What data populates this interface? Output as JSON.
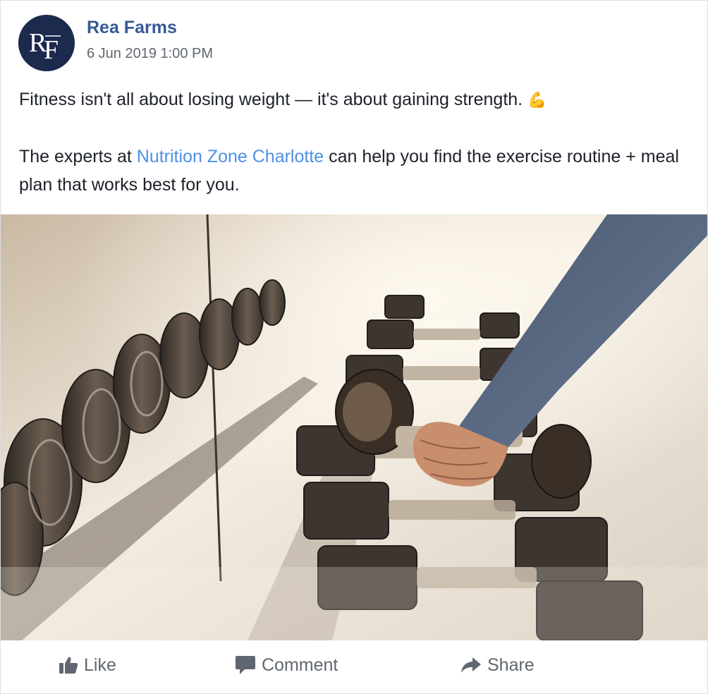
{
  "post": {
    "author": {
      "name": "Rea Farms",
      "avatar_monogram": "RF",
      "avatar_color": "#1b2a4d"
    },
    "timestamp": "6 Jun 2019 1:00 PM",
    "message": {
      "line1": "Fitness isn't all about losing weight — it's about gaining strength.",
      "line1_emoji": "💪",
      "line2_before": "The experts at",
      "mention": "Nutrition Zone Charlotte",
      "line2_after": "can help you find the exercise routine + meal plan that works best for you."
    },
    "image": {
      "subject": "hand lifting a dumbbell from a gym dumbbell rack"
    },
    "actions": [
      {
        "label": "Like",
        "icon": "thumbs-up-icon"
      },
      {
        "label": "Comment",
        "icon": "comment-icon"
      },
      {
        "label": "Share",
        "icon": "share-icon"
      }
    ]
  },
  "colors": {
    "name_link": "#385898",
    "mention_link": "#4e8fe8",
    "muted_text": "#606770",
    "body_text": "#1d2129"
  }
}
